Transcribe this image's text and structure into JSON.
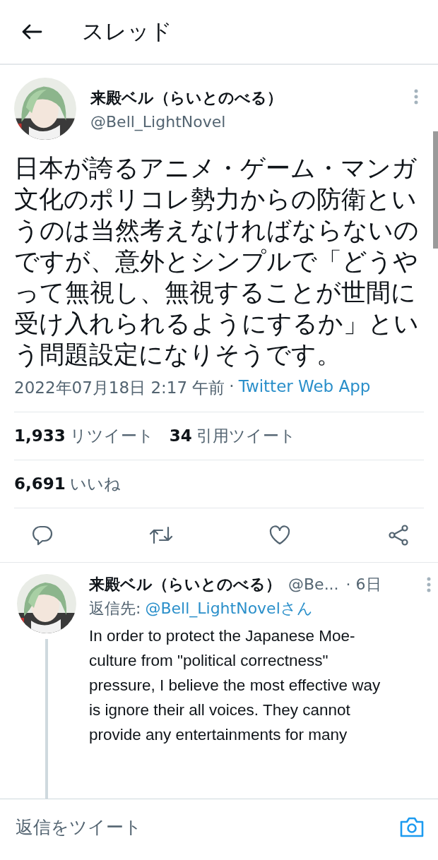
{
  "header": {
    "title": "スレッド"
  },
  "tweet": {
    "author": {
      "kind": "picture",
      "name": "来殿ベル（らいとのべる）",
      "handle": "@Bell_LightNovel"
    },
    "text": "日本が誇るアニメ・ゲーム・マンガ文化のポリコレ勢力からの防衛というのは当然考えなければならないのですが、意外とシンプルで「どうやって無視し、無視することが世間に受け入れられるようにするか」という問題設定になりそうです。",
    "timestamp": "2022年07月18日 2:17 午前",
    "separator": "·",
    "source": "Twitter Web App",
    "stats": [
      {
        "count": "1,933",
        "label": "リツイート"
      },
      {
        "count": "34",
        "label": "引用ツイート"
      }
    ],
    "likes": {
      "count": "6,691",
      "label": "いいね"
    },
    "actions": [
      {
        "kind": "reply"
      },
      {
        "kind": "retweet"
      },
      {
        "kind": "like"
      },
      {
        "kind": "share"
      }
    ]
  },
  "reply": {
    "author": {
      "kind": "picture",
      "name": "来殿ベル（らいとのべる）",
      "handle": "@Be...",
      "time": "· 6日"
    },
    "reply_to_label": "返信先:",
    "reply_to": "@Bell_LightNovelさん",
    "text": [
      "In order to protect the Japanese Moe-",
      "culture from \"political correctness\"",
      "pressure, I believe the most effective way",
      "is ignore  their all voices.  They cannot",
      "provide any entertainments for many"
    ]
  },
  "composer": {
    "placeholder": "返信をツイート"
  }
}
